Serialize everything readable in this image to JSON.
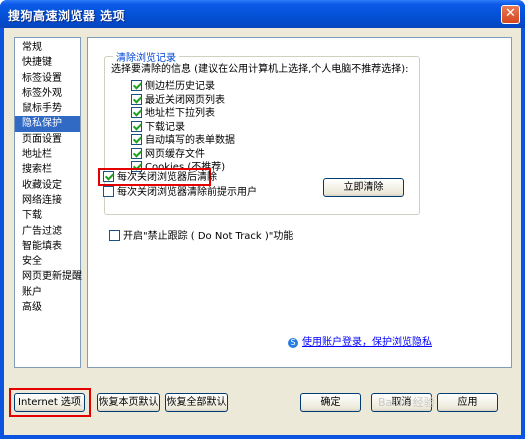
{
  "window": {
    "title": "搜狗高速浏览器 选项",
    "close_glyph": "✕"
  },
  "sidebar": {
    "items": [
      {
        "label": "常规"
      },
      {
        "label": "快捷键"
      },
      {
        "label": "标签设置"
      },
      {
        "label": "标签外观"
      },
      {
        "label": "鼠标手势"
      },
      {
        "label": "隐私保护",
        "selected": true
      },
      {
        "label": "页面设置"
      },
      {
        "label": "地址栏"
      },
      {
        "label": "搜索栏"
      },
      {
        "label": "收藏设定"
      },
      {
        "label": "网络连接"
      },
      {
        "label": "下载"
      },
      {
        "label": "广告过滤"
      },
      {
        "label": "智能填表"
      },
      {
        "label": "安全"
      },
      {
        "label": "网页更新提醒"
      },
      {
        "label": "账户"
      },
      {
        "label": "高级"
      }
    ]
  },
  "privacy": {
    "group_title": "清除浏览记录",
    "instruction": "选择要清除的信息 (建议在公用计算机上选择,个人电脑不推荐选择):",
    "options": [
      {
        "label": "侧边栏历史记录",
        "checked": true
      },
      {
        "label": "最近关闭网页列表",
        "checked": true
      },
      {
        "label": "地址栏下拉列表",
        "checked": true
      },
      {
        "label": "下载记录",
        "checked": true
      },
      {
        "label": "自动填写的表单数据",
        "checked": true
      },
      {
        "label": "网页缓存文件",
        "checked": true
      },
      {
        "label": "Cookies (不推荐)",
        "checked": true
      }
    ],
    "clear_on_close": {
      "label": "每次关闭浏览器后清除",
      "checked": true
    },
    "prompt_before_clear": {
      "label": "每次关闭浏览器清除前提示用户",
      "checked": false
    },
    "clear_now_label": "立即清除",
    "dnt": {
      "label": "开启\"禁止跟踪 ( Do Not Track )\"功能",
      "checked": false
    },
    "link_label": "使用账户登录，保护浏览隐私",
    "link_icon": "S"
  },
  "footer": {
    "internet_options_label": "Internet 选项",
    "restore_page_label": "恢复本页默认",
    "restore_all_label": "恢复全部默认",
    "ok_label": "确定",
    "cancel_label": "取消",
    "apply_label": "应用"
  },
  "watermark": "Baidu 经验"
}
